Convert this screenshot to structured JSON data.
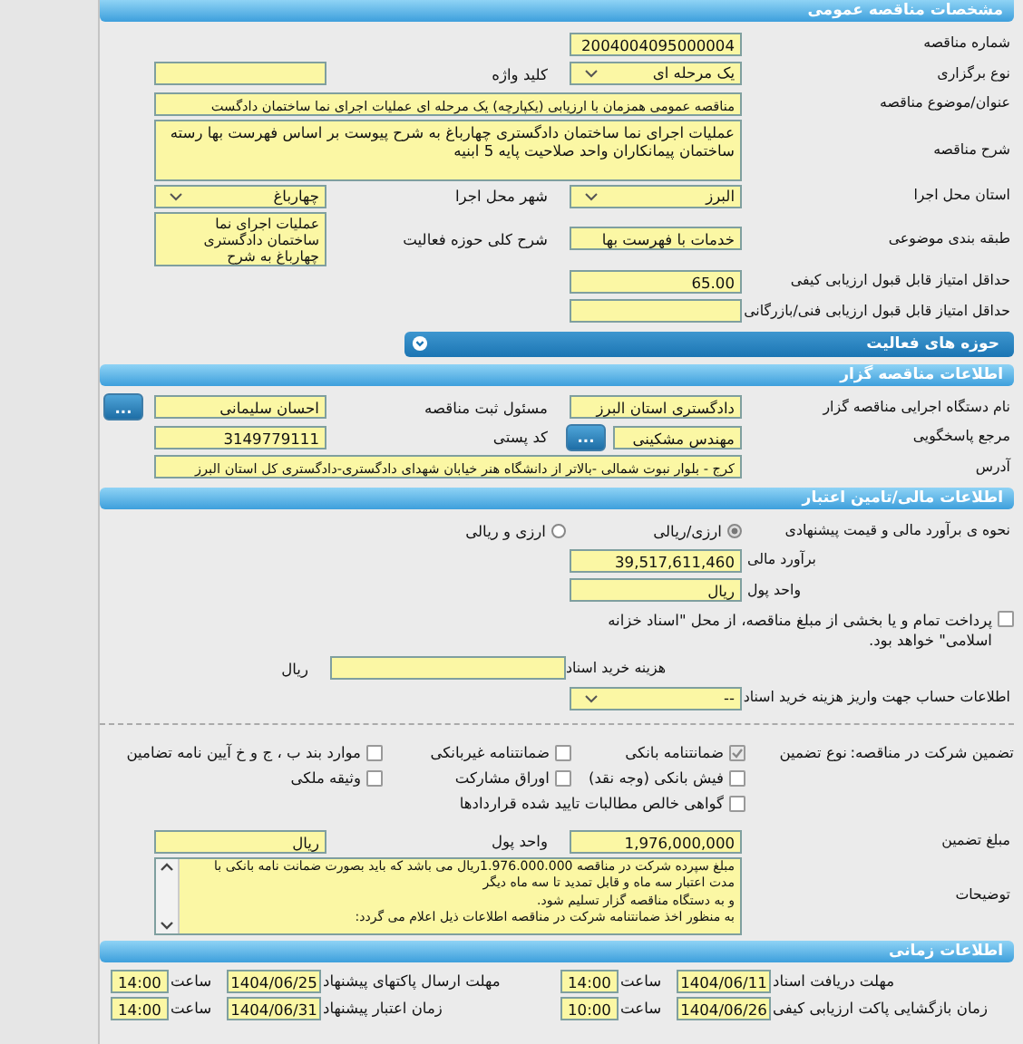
{
  "blocks": [
    {
      "kind": "header",
      "title": "مشخصات مناقصه عمومی"
    },
    {
      "kind": "row",
      "items": [
        {
          "kind": "label",
          "text": "شماره مناقصه"
        },
        {
          "kind": "text",
          "value": "2004004095000004"
        }
      ]
    },
    {
      "kind": "row",
      "items": [
        {
          "kind": "label",
          "text": "نوع برگزاری"
        },
        {
          "kind": "select",
          "value": "یک مرحله ای"
        },
        {
          "kind": "label",
          "text": "کلید واژه"
        },
        {
          "kind": "text"
        }
      ]
    },
    {
      "kind": "row",
      "items": [
        {
          "kind": "label",
          "text": "عنوان/موضوع مناقصه"
        },
        {
          "kind": "wide",
          "value": "مناقصه عمومی همزمان با ارزیابی (یکپارچه) یک مرحله ای عملیات اجرای نما ساختمان دادگست"
        }
      ]
    },
    {
      "kind": "row",
      "items": [
        {
          "kind": "label",
          "text": "شرح مناقصه"
        },
        {
          "kind": "area",
          "value": "عملیات اجرای نما ساختمان دادگستری چهارباغ به شرح پیوست بر اساس فهرست بها رسته ساختمان پیمانکاران واحد صلاحیت پایه 5 ابنیه"
        }
      ]
    },
    {
      "kind": "row",
      "items": [
        {
          "kind": "label",
          "text": "استان محل اجرا"
        },
        {
          "kind": "select",
          "value": "البرز"
        },
        {
          "kind": "label",
          "text": "شهر محل اجرا"
        },
        {
          "kind": "select",
          "value": "چهارباغ"
        }
      ]
    },
    {
      "kind": "row",
      "items": [
        {
          "kind": "label",
          "text": "طبقه بندی موضوعی"
        },
        {
          "kind": "text",
          "value": "خدمات با فهرست بها"
        },
        {
          "kind": "label",
          "text": "شرح کلی حوزه فعالیت"
        },
        {
          "kind": "small-area",
          "value": "عملیات اجرای نما ساختمان دادگستری چهارباغ به شرح"
        }
      ]
    },
    {
      "kind": "row",
      "items": [
        {
          "kind": "label",
          "text": "حداقل امتیاز قابل قبول ارزیابی کیفی"
        },
        {
          "kind": "text",
          "value": "65.00"
        }
      ]
    },
    {
      "kind": "row",
      "items": [
        {
          "kind": "label",
          "text": "حداقل امتیاز قابل قبول ارزیابی فنی/بازرگانی"
        },
        {
          "kind": "text"
        }
      ]
    },
    {
      "kind": "collapsible",
      "title": "حوزه های فعالیت"
    },
    {
      "kind": "header",
      "title": "اطلاعات مناقصه گزار"
    },
    {
      "kind": "row",
      "items": [
        {
          "kind": "label",
          "text": "نام دستگاه اجرایی مناقصه گزار"
        },
        {
          "kind": "text",
          "value": "دادگستری استان البرز"
        },
        {
          "kind": "label",
          "text": "مسئول ثبت مناقصه"
        },
        {
          "kind": "text",
          "value": "احسان سلیمانی"
        },
        {
          "kind": "button",
          "text": "..."
        }
      ]
    },
    {
      "kind": "row",
      "items": [
        {
          "kind": "label",
          "text": "مرجع پاسخگویی"
        },
        {
          "kind": "lookup",
          "value": "مهندس مشکینی",
          "button": "..."
        },
        {
          "kind": "label",
          "text": "کد پستی"
        },
        {
          "kind": "text",
          "value": "3149779111"
        }
      ]
    },
    {
      "kind": "row",
      "items": [
        {
          "kind": "label",
          "text": "آدرس"
        },
        {
          "kind": "wide",
          "value": "کرج - بلوار نبوت شمالی -بالاتر از دانشگاه هنر خیابان شهدای دادگستری-دادگستری کل استان البرز"
        }
      ]
    },
    {
      "kind": "header",
      "title": "اطلاعات مالی/تامین اعتبار"
    },
    {
      "kind": "row",
      "items": [
        {
          "kind": "label",
          "text": "نحوه ی برآورد مالی و قیمت پیشنهادی"
        },
        {
          "kind": "radio",
          "text": "ارزی/ریالی",
          "selected": true
        },
        {
          "kind": "radio",
          "text": "ارزی و ریالی",
          "selected": false
        }
      ]
    },
    {
      "kind": "row-end",
      "items": [
        {
          "kind": "label",
          "text": "برآورد مالی"
        },
        {
          "kind": "text",
          "value": "39,517,611,460"
        }
      ]
    },
    {
      "kind": "row-end",
      "items": [
        {
          "kind": "label",
          "text": "واحد پول"
        },
        {
          "kind": "text",
          "value": "ریال"
        }
      ]
    },
    {
      "kind": "check",
      "text": "پرداخت تمام و یا بخشی از مبلغ مناقصه، از محل \"اسناد خزانه اسلامی\" خواهد بود.",
      "checked": false
    },
    {
      "kind": "row-sub",
      "items": [
        {
          "kind": "label",
          "text": "هزینه خرید اسناد"
        },
        {
          "kind": "text"
        },
        {
          "kind": "label",
          "text": "ریال"
        }
      ]
    },
    {
      "kind": "row",
      "items": [
        {
          "kind": "label",
          "text": "اطلاعات حساب جهت واریز هزینه خرید اسناد"
        },
        {
          "kind": "select",
          "value": "--"
        }
      ]
    },
    {
      "kind": "divider"
    },
    {
      "kind": "guarantee",
      "title": "تضمین شرکت در مناقصه:",
      "type_label": "نوع تضمین",
      "options": [
        {
          "text": "ضمانتنامه بانکی",
          "checked": true
        },
        {
          "text": "ضمانتنامه غیربانکی",
          "checked": false
        },
        {
          "text": "موارد بند ب ، ج و خ آیین نامه تضامین",
          "checked": false
        },
        {
          "text": "فیش بانکی (وجه نقد)",
          "checked": false
        },
        {
          "text": "اوراق مشارکت",
          "checked": false
        },
        {
          "text": "وثیقه ملکی",
          "checked": false
        },
        {
          "text": "گواهی خالص مطالبات تایید شده قراردادها",
          "checked": false
        }
      ]
    },
    {
      "kind": "row",
      "items": [
        {
          "kind": "label",
          "text": "مبلغ تضمین"
        },
        {
          "kind": "text",
          "value": "1,976,000,000"
        },
        {
          "kind": "label",
          "text": "واحد پول"
        },
        {
          "kind": "text",
          "value": "ریال"
        }
      ]
    },
    {
      "kind": "row",
      "items": [
        {
          "kind": "label",
          "text": "توضیحات"
        },
        {
          "kind": "scroll-area",
          "value": "مبلغ سپرده شرکت در مناقصه 1.976.000.000ریال می باشد که باید بصورت ضمانت نامه بانکی با\nمدت اعتبار سه ماه و قابل تمدید تا سه ماه دیگر\nو به دستگاه مناقصه گزار تسلیم شود.\nبه منظور اخذ ضمانتنامه شرکت در مناقصه اطلاعات ذیل اعلام می گردد:"
        }
      ]
    },
    {
      "kind": "header",
      "title": "اطلاعات زمانی"
    },
    {
      "kind": "times",
      "rows": [
        [
          {
            "label": "مهلت دریافت اسناد",
            "date": "1404/06/11",
            "time_label": "ساعت",
            "time": "14:00"
          },
          {
            "label": "مهلت ارسال پاکتهای پیشنهاد",
            "date": "1404/06/25",
            "time_label": "ساعت",
            "time": "14:00"
          }
        ],
        [
          {
            "label": "زمان بازگشایی پاکت ارزیابی کیفی",
            "date": "1404/06/26",
            "time_label": "ساعت",
            "time": "10:00"
          },
          {
            "label": "زمان اعتبار پیشنهاد",
            "date": "1404/06/31",
            "time_label": "ساعت",
            "time": "14:00"
          }
        ]
      ]
    }
  ]
}
